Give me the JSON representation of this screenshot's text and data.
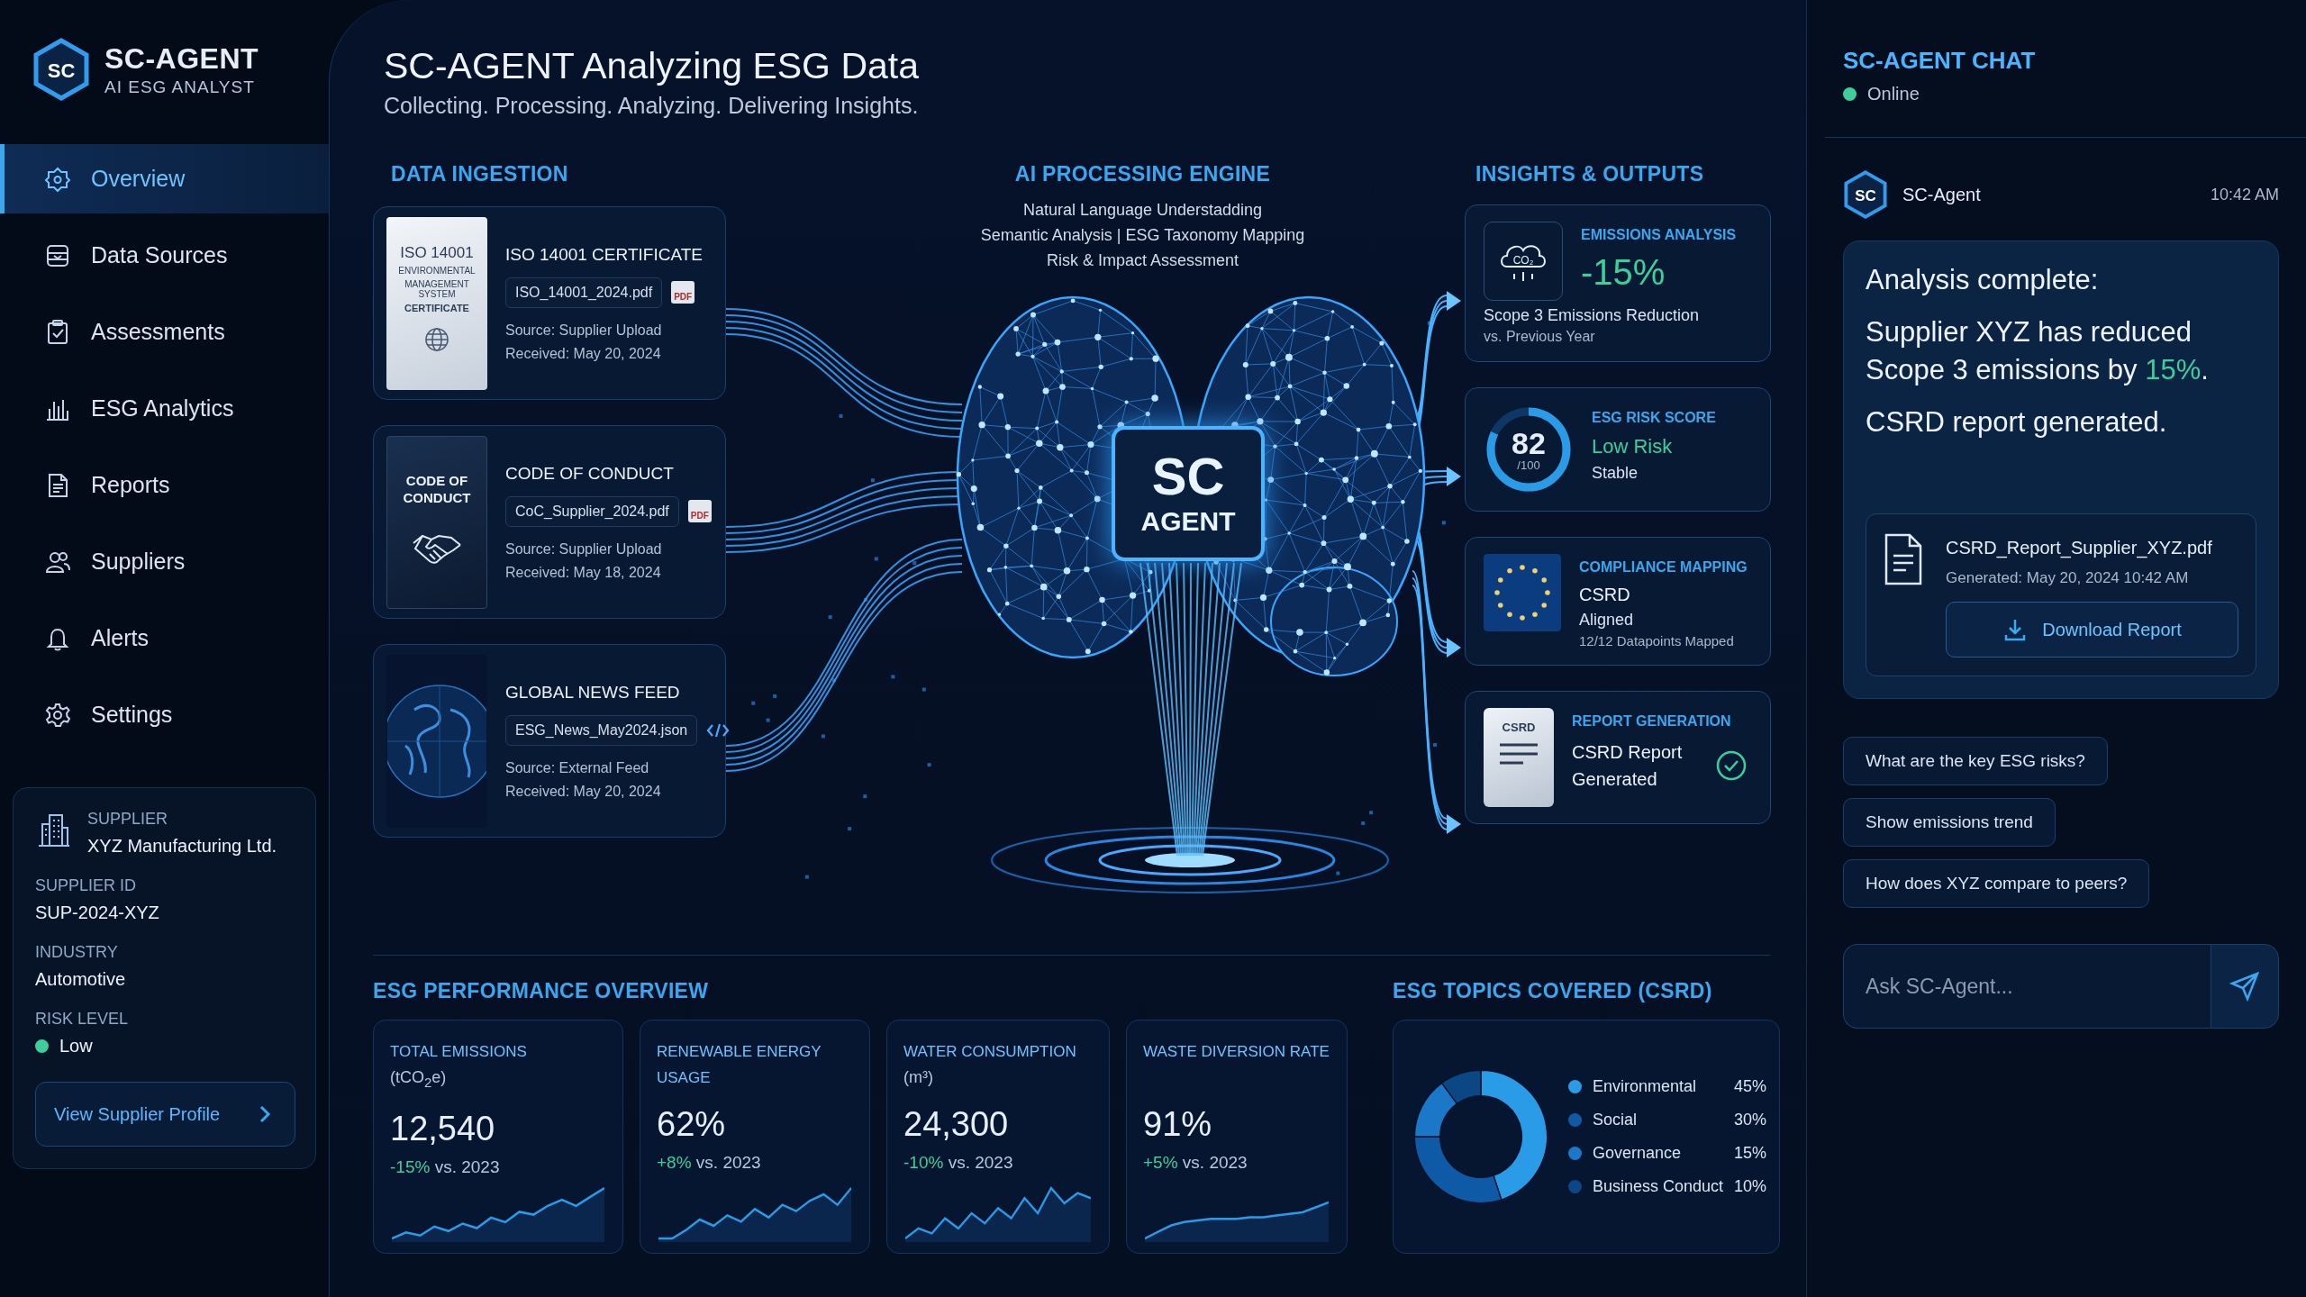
{
  "brand": {
    "mark": "SC",
    "name": "SC-AGENT",
    "tagline": "AI ESG ANALYST"
  },
  "nav": [
    {
      "label": "Overview",
      "selected": true
    },
    {
      "label": "Data Sources",
      "selected": false
    },
    {
      "label": "Assessments",
      "selected": false
    },
    {
      "label": "ESG Analytics",
      "selected": false
    },
    {
      "label": "Reports",
      "selected": false
    },
    {
      "label": "Suppliers",
      "selected": false
    },
    {
      "label": "Alerts",
      "selected": false
    },
    {
      "label": "Settings",
      "selected": false
    }
  ],
  "supplier_card": {
    "fields": [
      {
        "kind": "supplier",
        "label": "SUPPLIER",
        "value": "XYZ Manufacturing Ltd."
      },
      {
        "kind": "plain",
        "label": "SUPPLIER ID",
        "value": "SUP-2024-XYZ"
      },
      {
        "kind": "plain",
        "label": "INDUSTRY",
        "value": "Automotive"
      },
      {
        "kind": "status",
        "label": "RISK LEVEL",
        "value": "Low",
        "color": "#3ccf9a"
      }
    ],
    "button": "View Supplier Profile"
  },
  "header": {
    "title": "SC-AGENT Analyzing ESG Data",
    "subtitle": "Collecting. Processing. Analyzing. Delivering Insights."
  },
  "ingestion": {
    "heading": "DATA INGESTION",
    "sources": [
      {
        "kind": "certificate",
        "thumb_lines": [
          "ISO 14001",
          "ENVIRONMENTAL",
          "MANAGEMENT SYSTEM",
          "CERTIFICATE"
        ],
        "title": "ISO 14001 CERTIFICATE",
        "file": "ISO_14001_2024.pdf",
        "badge": "PDF",
        "source": "Source: Supplier Upload",
        "received": "Received: May 20, 2024"
      },
      {
        "kind": "booklet",
        "thumb_lines": [
          "CODE OF",
          "CONDUCT"
        ],
        "title": "CODE OF CONDUCT",
        "file": "CoC_Supplier_2024.pdf",
        "badge": "PDF",
        "source": "Source: Supplier Upload",
        "received": "Received: May 18, 2024"
      },
      {
        "kind": "globe",
        "title": "GLOBAL NEWS FEED",
        "file": "ESG_News_May2024.json",
        "source": "Source: External Feed",
        "received": "Received: May 20, 2024"
      }
    ]
  },
  "engine": {
    "heading": "AI PROCESSING ENGINE",
    "lines": [
      "Natural Language Understadding",
      "Semantic Analysis | ESG Taxonomy Mapping",
      "Risk & Impact Assessment"
    ],
    "chip": [
      "SC",
      "AGENT"
    ]
  },
  "insights": {
    "heading": "INSIGHTS & OUTPUTS",
    "cards": [
      {
        "kind": "emissions",
        "icon_text": "CO₂",
        "title": "EMISSIONS ANALYSIS",
        "value": "-15%",
        "caption": "Scope 3 Emissions Reduction",
        "note": "vs. Previous Year"
      },
      {
        "kind": "score",
        "title": "ESG RISK SCORE",
        "score": "82",
        "out_of": "/100",
        "level": 0.82,
        "status": "Low Risk",
        "note": "Stable"
      },
      {
        "kind": "compliance",
        "title": "COMPLIANCE MAPPING",
        "value": "CSRD",
        "status": "Aligned",
        "note": "12/12 Datapoints Mapped"
      },
      {
        "kind": "report",
        "icon_text": "CSRD",
        "title": "REPORT GENERATION",
        "caption": "CSRD Report Generated",
        "completed": true
      }
    ]
  },
  "performance": {
    "heading": "ESG PERFORMANCE OVERVIEW",
    "kpis": [
      {
        "title": "TOTAL EMISSIONS",
        "unit": "(tCO$_{2}$e)",
        "value": "12,540",
        "delta": "-15%",
        "delta_note": "vs. 2023"
      },
      {
        "title": "RENEWABLE ENERGY USAGE",
        "value": "62%",
        "delta": "+8%",
        "delta_note": "vs. 2023"
      },
      {
        "title": "WATER CONSUMPTION",
        "unit": "(m³)",
        "value": "24,300",
        "delta": "-10%",
        "delta_note": "vs. 2023"
      },
      {
        "title": "WASTE DIVERSION RATE",
        "value": "91%",
        "delta": "+5%",
        "delta_note": "vs. 2023"
      }
    ]
  },
  "topics": {
    "heading": "ESG TOPICS COVERED (CSRD)",
    "chart_data": {
      "type": "donut",
      "categories": [
        "Environmental",
        "Social",
        "Governance",
        "Business Conduct"
      ],
      "values": [
        45,
        30,
        15,
        10
      ]
    },
    "legend": [
      {
        "value": "45%",
        "color": "#2a9be6"
      },
      {
        "value": "30%",
        "color": "#0f5aa6"
      },
      {
        "value": "15%",
        "color": "#1b78c8"
      },
      {
        "value": "10%",
        "color": "#0c4785"
      }
    ]
  },
  "chat": {
    "title": "SC-AGENT CHAT",
    "online": true,
    "status": "Online",
    "message": {
      "avatar": "SC",
      "sender": "SC-Agent",
      "time": "10:42 AM",
      "paragraphs": [
        "Analysis complete:",
        "Supplier XYZ has reduced Scope 3 emissions by **15%**.",
        "CSRD report generated."
      ],
      "attachment": {
        "name": "CSRD_Report_Supplier_XYZ.pdf",
        "meta": "Generated: May 20, 2024 10:42 AM",
        "button": "Download Report"
      }
    },
    "suggestions": [
      "What are the key ESG risks?",
      "Show emissions trend",
      "How does XYZ compare to peers?"
    ],
    "input": {
      "placeholder": "Ask SC-Agent..."
    }
  }
}
